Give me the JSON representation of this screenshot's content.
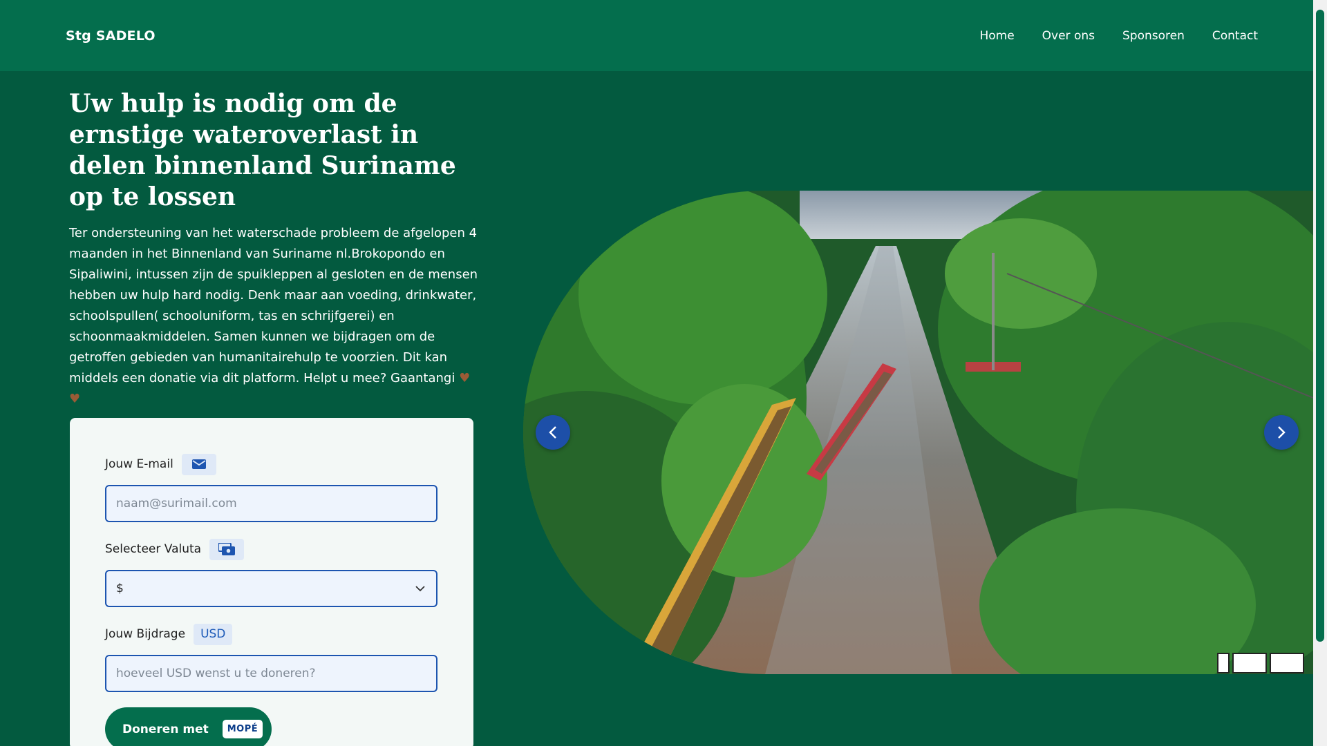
{
  "nav": {
    "brand": "Stg SADELO",
    "links": [
      "Home",
      "Over ons",
      "Sponsoren",
      "Contact"
    ]
  },
  "hero": {
    "headline": "Uw hulp is nodig om de ernstige wateroverlast in delen binnenland Suriname op te lossen",
    "intro": "Ter ondersteuning van het waterschade probleem de afgelopen 4 maanden in het Binnenland van Suriname nl.Brokopondo en Sipaliwini, intussen zijn de spuikleppen al gesloten en de mensen hebben uw hulp hard nodig. Denk maar aan voeding, drinkwater, schoolspullen( schooluniform, tas en schrijfgerei) en schoonmaakmiddelen. Samen kunnen we bijdragen om de getroffen gebieden van humanitairehulp te voorzien. Dit kan middels een donatie via dit platform. Helpt u mee? Gaantangi",
    "hearts": "♥ ♥"
  },
  "form": {
    "email_label": "Jouw E-mail",
    "email_icon": "envelope-icon",
    "email_placeholder": "naam@surimail.com",
    "currency_label": "Selecteer Valuta",
    "currency_icon": "money-icon",
    "currency_value": "$",
    "amount_label": "Jouw Bijdrage",
    "amount_badge": "USD",
    "amount_placeholder": "hoeveel USD wenst u te doneren?",
    "donate_label": "Doneren met",
    "donate_badge": "MOPÉ"
  },
  "carousel": {
    "prev_icon": "chevron-left-icon",
    "next_icon": "chevron-right-icon",
    "image_subject": "flooded river with canoes in the Surinamese interior"
  },
  "colors": {
    "page_bg": "#035a3f",
    "navbar_bg": "#046e4d",
    "accent_blue": "#1d55b0",
    "card_bg": "#f3f8f6"
  }
}
